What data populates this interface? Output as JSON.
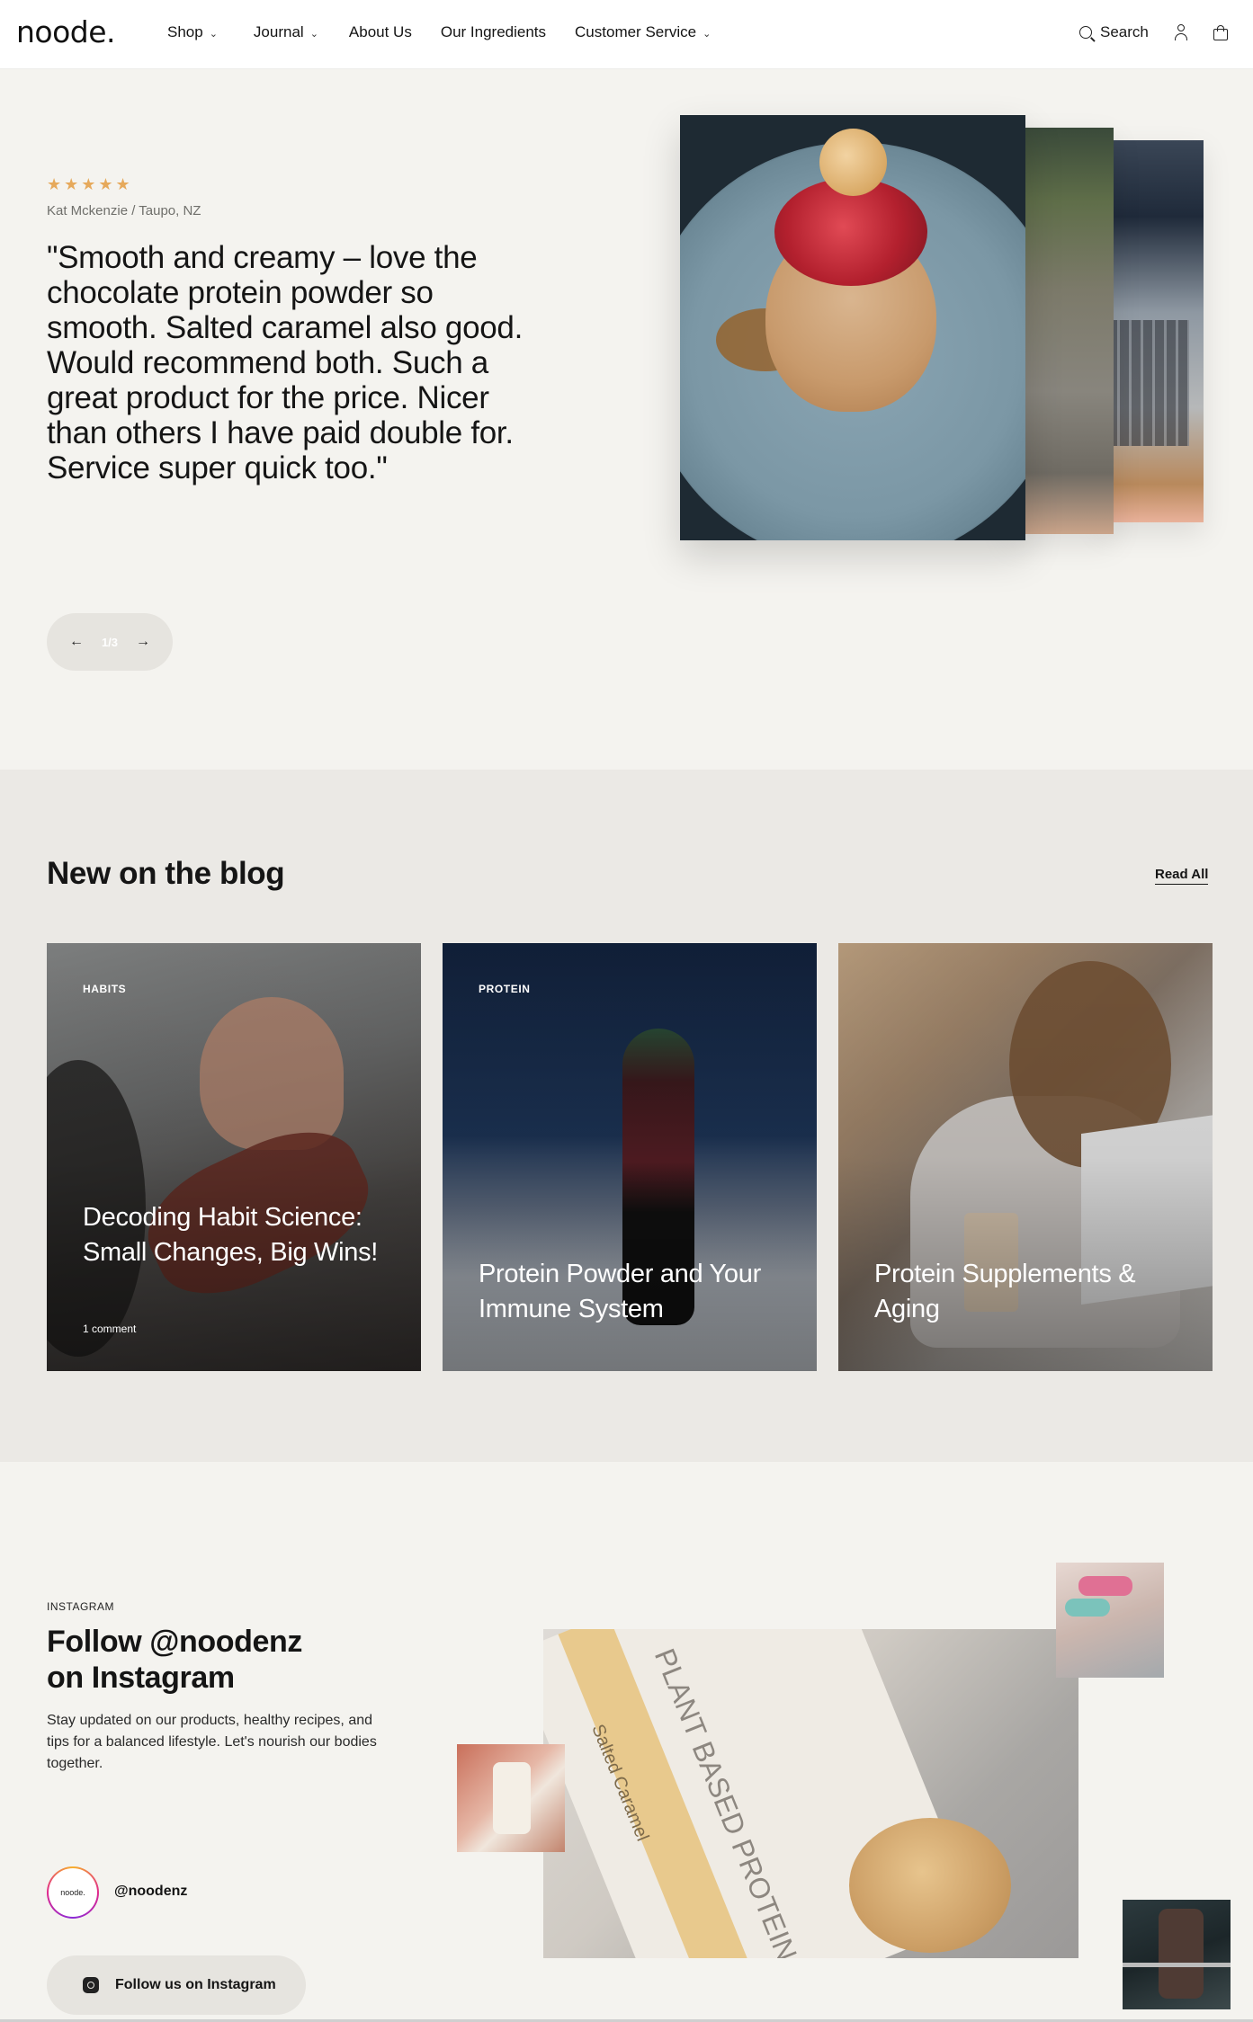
{
  "header": {
    "logo": "noode.",
    "nav": [
      {
        "label": "Shop",
        "has_dropdown": true
      },
      {
        "label": "Journal",
        "has_dropdown": true
      },
      {
        "label": "About Us",
        "has_dropdown": false
      },
      {
        "label": "Our Ingredients",
        "has_dropdown": false
      },
      {
        "label": "Customer Service",
        "has_dropdown": true
      }
    ],
    "search_label": "Search",
    "icons": [
      "search-icon",
      "user-icon",
      "bag-icon"
    ]
  },
  "testimonial": {
    "rating": 5,
    "stars": "★★★★★",
    "reviewer": "Kat Mckenzie  / Taupo, NZ",
    "quote": "\"Smooth and creamy – love the chocolate protein powder so smooth. Salted caramel also good. Would recommend both. Such a great product for the price. Nicer than others I have paid double for. Service super quick too.\"",
    "slider_count": "1/3",
    "prev_icon": "arrow-left-icon",
    "next_icon": "arrow-right-icon"
  },
  "blog": {
    "title": "New on the blog",
    "read_all": "Read All",
    "cards": [
      {
        "tag": "HABITS",
        "title": "Decoding Habit Science: Small Changes, Big Wins!",
        "comments": "1 comment"
      },
      {
        "tag": "PROTEIN",
        "title": "Protein Powder and Your Immune System",
        "comments": ""
      },
      {
        "tag": "",
        "title": "Protein Supplements & Aging",
        "comments": ""
      }
    ]
  },
  "instagram": {
    "kicker": "INSTAGRAM",
    "title_line1": "Follow @noodenz",
    "title_line2": "on Instagram",
    "description": "Stay updated on our products, healthy recipes, and tips for a balanced lifestyle. Let's nourish our bodies together.",
    "avatar_text": "noode.",
    "handle": "@noodenz",
    "follow_button": "Follow us on Instagram",
    "product_text_1": "PLANT BASED PROTEIN",
    "product_text_2": "Salted Caramel"
  },
  "colors": {
    "page_bg": "#f4f3ef",
    "blog_bg": "#ebe9e5",
    "star": "#e6a95b",
    "pill_bg": "#e6e4df"
  }
}
